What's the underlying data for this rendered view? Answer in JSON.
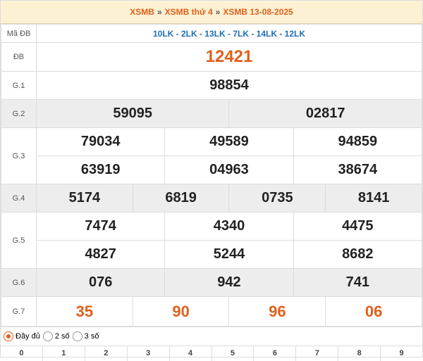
{
  "header": {
    "crumb1": "XSMB",
    "sep": "»",
    "crumb2": "XSMB thứ 4",
    "crumb3": "XSMB 13-08-2025"
  },
  "madb": {
    "label": "Mã ĐB",
    "codes": "10LK - 2LK - 13LK - 7LK - 14LK - 12LK"
  },
  "prizes": {
    "db": {
      "label": "ĐB",
      "values": [
        "12421"
      ]
    },
    "g1": {
      "label": "G.1",
      "values": [
        "98854"
      ]
    },
    "g2": {
      "label": "G.2",
      "values": [
        "59095",
        "02817"
      ]
    },
    "g3": {
      "label": "G.3",
      "values": [
        "79034",
        "49589",
        "94859",
        "63919",
        "04963",
        "38674"
      ]
    },
    "g4": {
      "label": "G.4",
      "values": [
        "5174",
        "6819",
        "0735",
        "8141"
      ]
    },
    "g5": {
      "label": "G.5",
      "values": [
        "7474",
        "4340",
        "4475",
        "4827",
        "5244",
        "8682"
      ]
    },
    "g6": {
      "label": "G.6",
      "values": [
        "076",
        "942",
        "741"
      ]
    },
    "g7": {
      "label": "G.7",
      "values": [
        "35",
        "90",
        "96",
        "06"
      ]
    }
  },
  "options": [
    "Đầy đủ",
    "2 số",
    "3 số"
  ],
  "selected_option": "Đầy đủ",
  "digit_heads": [
    "0",
    "1",
    "2",
    "3",
    "4",
    "5",
    "6",
    "7",
    "8",
    "9"
  ],
  "colors": {
    "accent": "#e0601c",
    "code_blue": "#1f6fb5",
    "header_bg": "#fdf1d4",
    "gray_row": "#ededed"
  }
}
